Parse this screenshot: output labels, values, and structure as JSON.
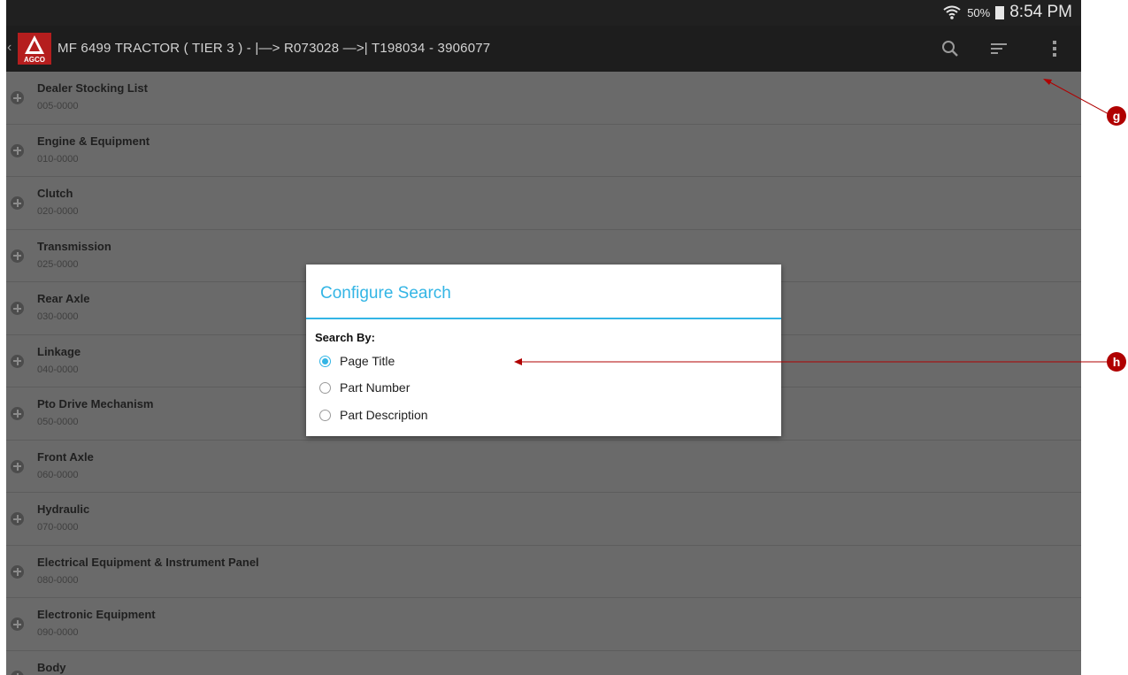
{
  "status_bar": {
    "battery": "50%",
    "time": "8:54 PM"
  },
  "action_bar": {
    "logo_text": "AGCO",
    "title": "MF 6499  TRACTOR ( TIER 3 ) -  |—> R073028  —>| T198034 - 3906077"
  },
  "list_items": [
    {
      "name": "Dealer Stocking List",
      "code": "005-0000"
    },
    {
      "name": "Engine & Equipment",
      "code": "010-0000"
    },
    {
      "name": "Clutch",
      "code": "020-0000"
    },
    {
      "name": "Transmission",
      "code": "025-0000"
    },
    {
      "name": "Rear Axle",
      "code": "030-0000"
    },
    {
      "name": "Linkage",
      "code": "040-0000"
    },
    {
      "name": "Pto Drive Mechanism",
      "code": "050-0000"
    },
    {
      "name": "Front Axle",
      "code": "060-0000"
    },
    {
      "name": "Hydraulic",
      "code": "070-0000"
    },
    {
      "name": "Electrical Equipment & Instrument Panel",
      "code": "080-0000"
    },
    {
      "name": "Electronic Equipment",
      "code": "090-0000"
    },
    {
      "name": "Body",
      "code": ""
    }
  ],
  "dialog": {
    "title": "Configure Search",
    "label": "Search By:",
    "options": [
      {
        "label": "Page Title",
        "selected": true
      },
      {
        "label": "Part Number",
        "selected": false
      },
      {
        "label": "Part Description",
        "selected": false
      }
    ]
  },
  "annotations": {
    "g": "g",
    "h": "h"
  },
  "colors": {
    "accent": "#33b5e5",
    "annotation": "#b00000",
    "logo": "#b51e1e"
  }
}
